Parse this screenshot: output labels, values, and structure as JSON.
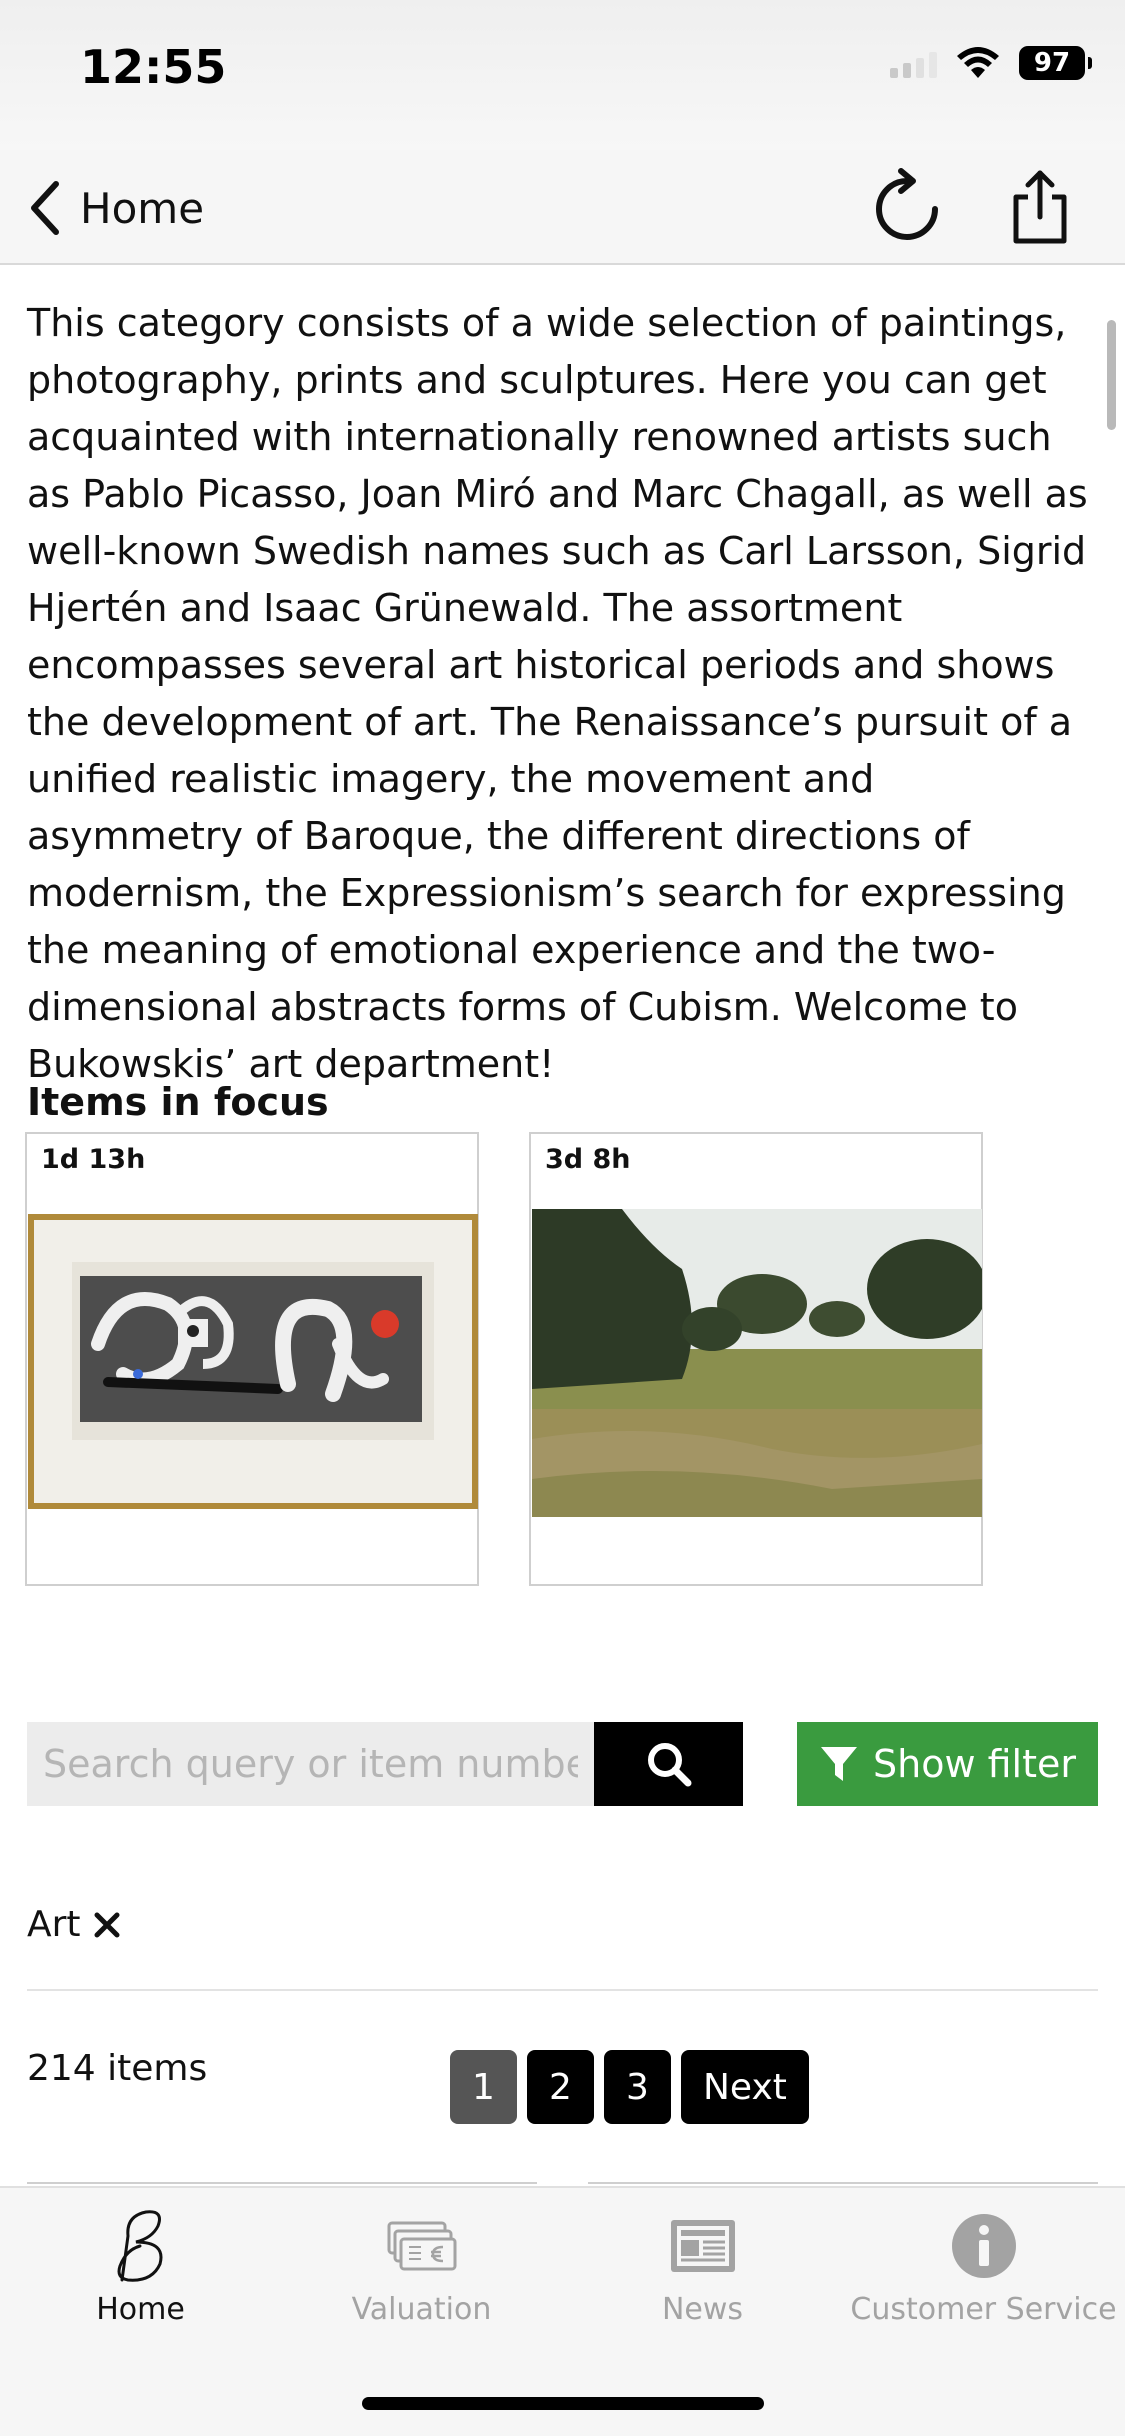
{
  "status_bar": {
    "time": "12:55",
    "battery": "97"
  },
  "nav": {
    "back_label": "Home"
  },
  "description": "This category consists of a wide selection of paintings, photography, prints and sculptures. Here you can get acquainted with internationally renowned artists such as Pablo Picasso, Joan Miró and Marc Chagall, as well as well-known Swedish names such as Carl Larsson, Sigrid Hjertén and Isaac Grünewald. The assortment encompasses several art historical periods and shows the development of art. The Renaissance’s pursuit of a unified realistic imagery, the movement and asymmetry of Baroque, the different directions of modernism, the Expressionism’s search for expressing the meaning of emotional experience and the two-dimensional abstracts forms of Cubism. Welcome to Bukowskis’ art department!",
  "focus": {
    "title": "Items in focus",
    "items": [
      {
        "time_left": "1d 13h"
      },
      {
        "time_left": "3d 8h"
      }
    ]
  },
  "search": {
    "placeholder": "Search query or item number",
    "value": ""
  },
  "filter": {
    "label": "Show filter",
    "color": "#3a9b3f"
  },
  "active_tag": {
    "label": "Art"
  },
  "results": {
    "count_label": "214 items"
  },
  "pagination": {
    "pages": [
      "1",
      "2",
      "3"
    ],
    "next_label": "Next",
    "current": "1"
  },
  "tabs": [
    {
      "label": "Home",
      "icon": "bukowskis-logo-icon",
      "active": true
    },
    {
      "label": "Valuation",
      "icon": "banknotes-icon",
      "active": false
    },
    {
      "label": "News",
      "icon": "newspaper-icon",
      "active": false
    },
    {
      "label": "Customer Service",
      "icon": "info-icon",
      "active": false
    }
  ]
}
